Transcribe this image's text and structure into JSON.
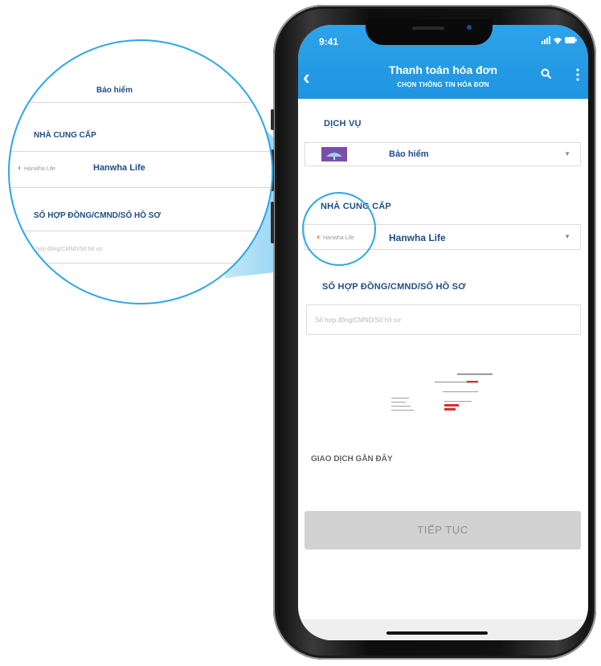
{
  "status": {
    "time": "9:41"
  },
  "appbar": {
    "title": "Thanh toán hóa đơn",
    "subtitle": "CHỌN THÔNG TIN HÓA ĐƠN"
  },
  "form": {
    "service_label": "DỊCH VỤ",
    "service_value": "Bảo hiểm",
    "provider_label": "NHÀ CUNG CẤP",
    "provider_value": "Hanwha Life",
    "provider_logo_text": "Hanwha Life",
    "contract_label": "SỐ HỢP ĐỒNG/CMND/SỐ HỒ SƠ",
    "contract_placeholder": "Số hợp đồng/CMND/Số hồ sơ",
    "contract_value": ""
  },
  "recent": {
    "label": "GIAO DỊCH GẦN ĐÂY"
  },
  "continue_button": {
    "label": "TIẾP TỤC"
  },
  "magnifier": {
    "service_value": "Bảo hiểm",
    "provider_label": "NHÀ CUNG CẤP",
    "provider_value": "Hanwha Life",
    "provider_logo_text": "Hanwha Life",
    "contract_label": "SỐ HỢP ĐỒNG/CMND/SỐ HỒ SƠ",
    "contract_placeholder": "Số hợp đồng/CMND/Số hồ sơ"
  },
  "colors": {
    "appbar": "#1f94e0",
    "label": "#1f4d86",
    "magnifier_ring": "#2aa7e6",
    "button_disabled": "#d2d2d2"
  },
  "icons": [
    "back-arrow-icon",
    "search-icon",
    "more-vertical-icon",
    "umbrella-icon",
    "hanwha-logo-icon",
    "caret-down-icon",
    "signal-icon",
    "wifi-icon",
    "battery-icon"
  ]
}
